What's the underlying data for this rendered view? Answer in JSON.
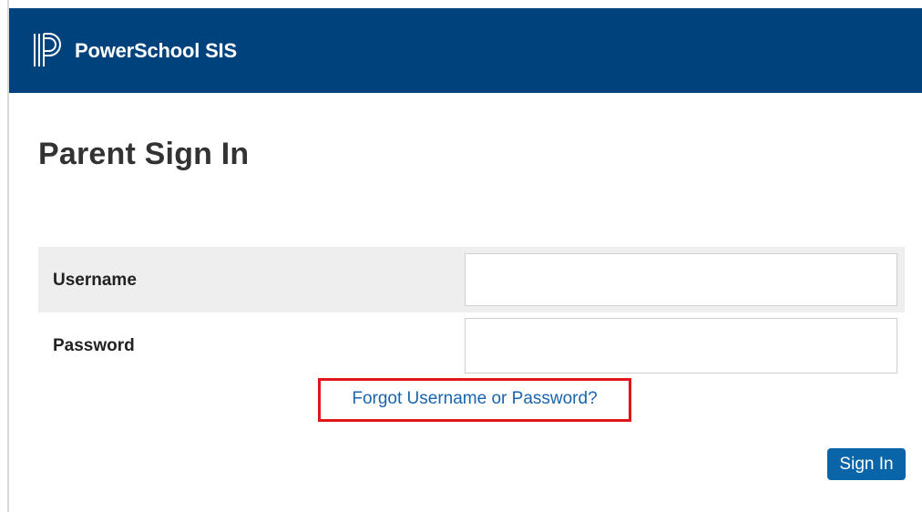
{
  "header": {
    "brand": "PowerSchool SIS",
    "logo_icon": "powerschool-logo-icon"
  },
  "page": {
    "title": "Parent Sign In"
  },
  "form": {
    "username_label": "Username",
    "username_value": "",
    "password_label": "Password",
    "password_value": "",
    "forgot_link": "Forgot Username or Password?",
    "sign_in_button": "Sign In"
  },
  "colors": {
    "header_bg": "#00427c",
    "link": "#1a64ae",
    "button_bg": "#0a65a8",
    "highlight_border": "#e0161a",
    "row_bg": "#eeeeee"
  }
}
